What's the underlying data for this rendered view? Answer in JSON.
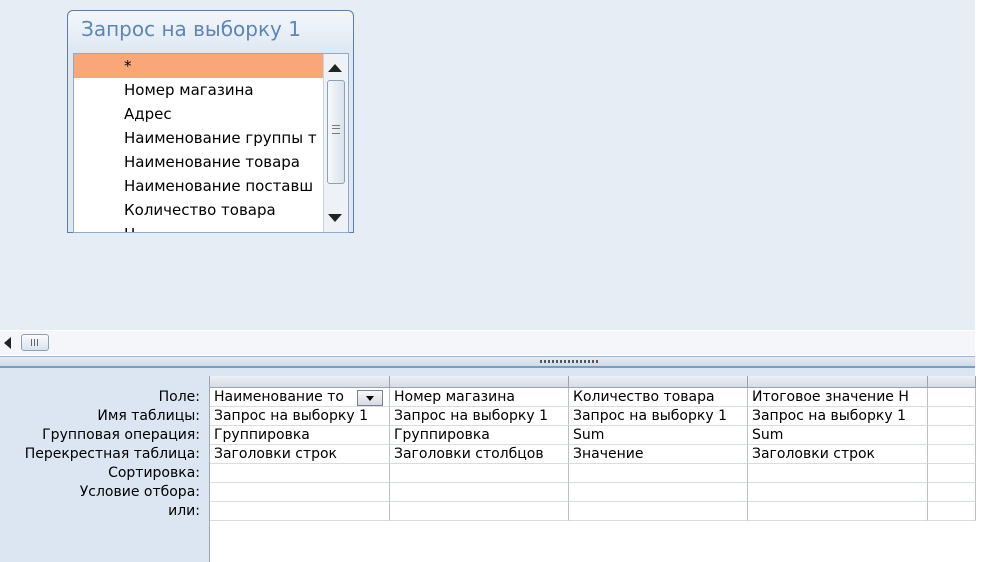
{
  "field_list": {
    "title": "Запрос на выборку 1",
    "items": [
      {
        "label": "*",
        "selected": true
      },
      {
        "label": "Номер магазина"
      },
      {
        "label": "Адрес"
      },
      {
        "label": "Наименование группы т"
      },
      {
        "label": "Наименование товара"
      },
      {
        "label": "Наименование поставш"
      },
      {
        "label": "Количество товара"
      },
      {
        "label": "Ц"
      }
    ]
  },
  "grid": {
    "row_labels": [
      "Поле:",
      "Имя таблицы:",
      "Групповая операция:",
      "Перекрестная таблица:",
      "Сортировка:",
      "Условие отбора:",
      "или:"
    ],
    "columns": [
      {
        "field": "Наименование то",
        "table": "Запрос на выборку 1",
        "group": "Группировка",
        "crosstab": "Заголовки строк",
        "sort": "",
        "criteria": "",
        "or": ""
      },
      {
        "field": "Номер магазина",
        "table": "Запрос на выборку 1",
        "group": "Группировка",
        "crosstab": "Заголовки столбцов",
        "sort": "",
        "criteria": "",
        "or": ""
      },
      {
        "field": "Количество товара",
        "table": "Запрос на выборку 1",
        "group": "Sum",
        "crosstab": "Значение",
        "sort": "",
        "criteria": "",
        "or": ""
      },
      {
        "field": "Итоговое значение Н",
        "table": "Запрос на выборку 1",
        "group": "Sum",
        "crosstab": "Заголовки строк",
        "sort": "",
        "criteria": "",
        "or": ""
      },
      {
        "field": "",
        "table": "",
        "group": "",
        "crosstab": "",
        "sort": "",
        "criteria": "",
        "or": ""
      }
    ]
  },
  "colors": {
    "pane_background": "#e6edf4",
    "grid_background": "#dbe6f2",
    "selected_field": "#f9a679",
    "title_text": "#5d86b5"
  },
  "icons": {
    "scroll_up": "scroll-up-arrow-icon",
    "scroll_down": "scroll-down-arrow-icon",
    "scroll_left": "scroll-left-arrow-icon",
    "dropdown": "chevron-down-icon"
  }
}
